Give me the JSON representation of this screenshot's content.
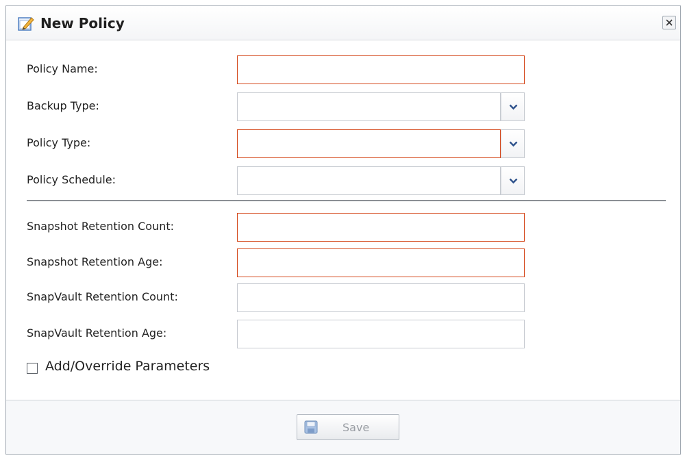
{
  "dialog": {
    "title": "New Policy",
    "icon": "edit-document-icon",
    "close_icon": "close-icon"
  },
  "form": {
    "policy_name": {
      "label": "Policy Name:",
      "value": "",
      "required": true
    },
    "backup_type": {
      "label": "Backup Type:",
      "value": "",
      "required": false
    },
    "policy_type": {
      "label": "Policy Type:",
      "value": "",
      "required": true
    },
    "policy_schedule": {
      "label": "Policy Schedule:",
      "value": "",
      "required": false
    },
    "snapshot_retention_count": {
      "label": "Snapshot Retention Count:",
      "value": "",
      "required": true
    },
    "snapshot_retention_age": {
      "label": "Snapshot Retention Age:",
      "value": "",
      "required": true
    },
    "snapvault_retention_count": {
      "label": "SnapVault Retention Count:",
      "value": "",
      "required": false
    },
    "snapvault_retention_age": {
      "label": "SnapVault Retention Age:",
      "value": "",
      "required": false
    },
    "add_override": {
      "label": "Add/Override Parameters",
      "checked": false
    }
  },
  "footer": {
    "save_label": "Save",
    "save_icon": "floppy-disk-icon",
    "save_enabled": false
  },
  "colors": {
    "required_border": "#d4471a",
    "normal_border": "#c6cad0",
    "arrow": "#2b4f8a"
  }
}
